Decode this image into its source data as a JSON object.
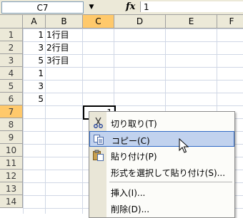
{
  "formula_bar": {
    "name_box": "C7",
    "fx_label": "fx",
    "value": "1"
  },
  "columns": [
    "A",
    "B",
    "C",
    "D",
    "E",
    "F"
  ],
  "rows": [
    "1",
    "2",
    "3",
    "4",
    "5",
    "6",
    "7",
    "8",
    "9",
    "10",
    "11",
    "12",
    "13",
    "14"
  ],
  "cells": {
    "A1": "1",
    "B1": "1行目",
    "A2": "3",
    "B2": "2行目",
    "A3": "5",
    "B3": "3行目",
    "A4": "1",
    "A5": "3",
    "A6": "5",
    "C7": "1"
  },
  "context_menu": {
    "items": [
      {
        "label": "切り取り(T)",
        "icon": "scissors-icon"
      },
      {
        "label": "コピー(C)",
        "icon": "copy-icon"
      },
      {
        "label": "貼り付け(P)",
        "icon": "paste-icon"
      },
      {
        "label": "形式を選択して貼り付け(S)..."
      },
      {
        "label": "挿入(I)..."
      },
      {
        "label": "削除(D)..."
      }
    ],
    "highlighted_item": "コピー(C)"
  },
  "colors": {
    "header_bg": "#ece9d8",
    "selected_header": "#ffc96b",
    "menu_highlight": "#c1d2ee",
    "gridline": "#d0d7e5"
  }
}
